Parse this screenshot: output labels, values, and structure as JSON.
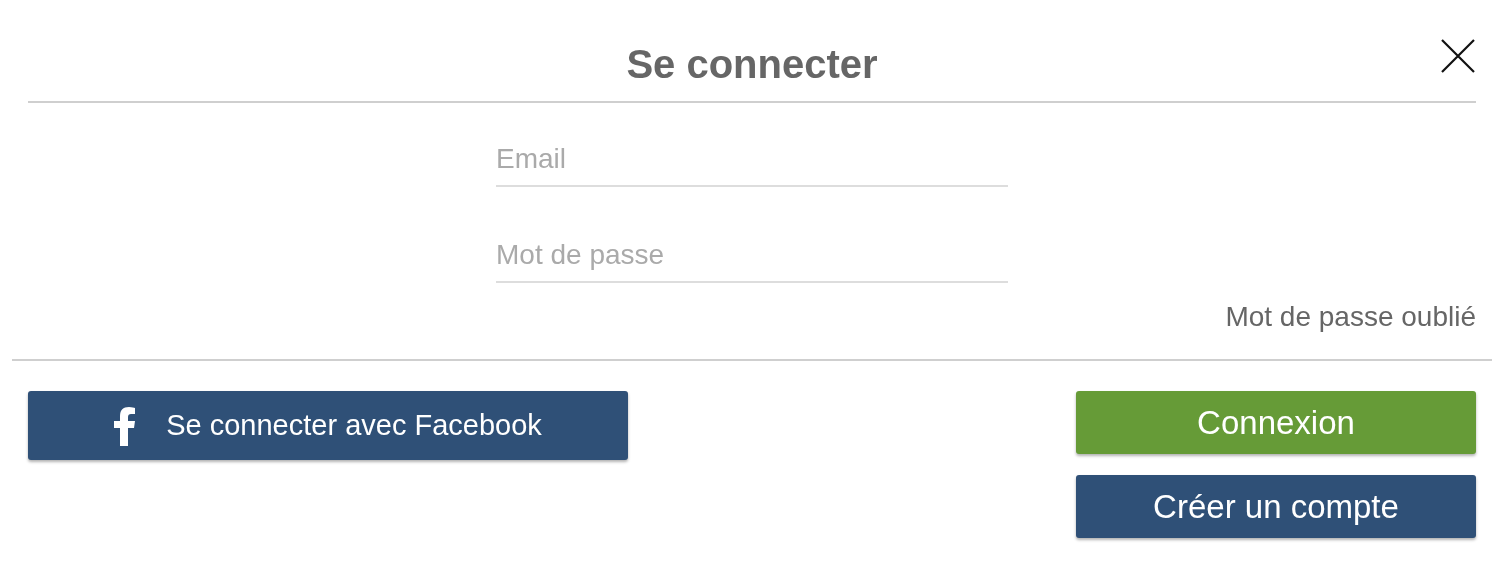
{
  "dialog": {
    "title": "Se connecter"
  },
  "fields": [
    {
      "placeholder": "Email"
    },
    {
      "placeholder": "Mot de passe"
    }
  ],
  "forgot_link": "Mot de passe oublié",
  "facebook_button": {
    "label": "Se connecter avec Facebook"
  },
  "buttons": [
    {
      "label": "Connexion",
      "kind": "primary"
    },
    {
      "label": "Créer un compte",
      "kind": "secondary"
    }
  ]
}
